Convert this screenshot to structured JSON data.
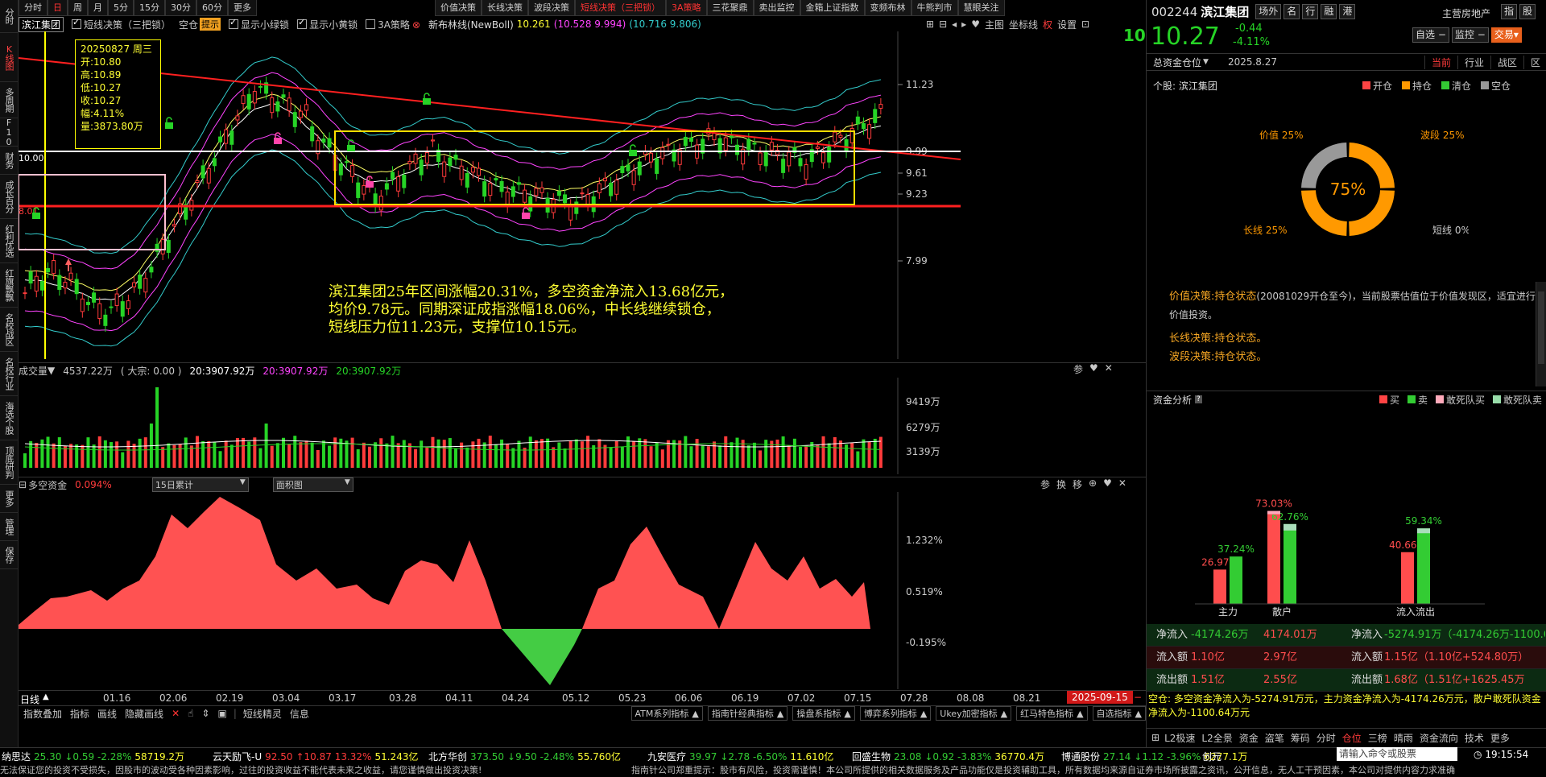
{
  "left_tabs": [
    "分时",
    "K线图",
    "多周期",
    "F10",
    "财务",
    "成长百分",
    "红利优选",
    "红旗飘飘",
    "名校战区",
    "名校行业",
    "海选个股",
    "顶底研判",
    "更多",
    "管理",
    "保存"
  ],
  "period_tabs": [
    "分时",
    "日",
    "周",
    "月",
    "5分",
    "15分",
    "30分",
    "60分",
    "更多"
  ],
  "period_active": "日",
  "decision_tabs": [
    "价值决策",
    "长线决策",
    "波段决策",
    "短线决策（三把锁）",
    "3A策略",
    "三花聚鼎",
    "卖出监控",
    "金箱上证指数",
    "变频布林",
    "牛熊判市",
    "慧眼关注"
  ],
  "decision_red": [
    "短线决策（三把锁）",
    "3A策略"
  ],
  "main_sub": {
    "name": "滨江集团",
    "indicator": "短线决策（三把锁）",
    "kongcang": "空仓",
    "tips": "提示",
    "opt1": "显示小绿锁",
    "opt2": "显示小黄锁",
    "opt3": "3A策略",
    "boll": "新布林线(NewBoll)",
    "boll_v1": "10.261",
    "boll_v2": "(10.528 9.994)",
    "boll_v3": "(10.716 9.806)",
    "right_tools": [
      "主图",
      "坐标线",
      "权",
      "设置"
    ],
    "right_big": "10.27"
  },
  "tooltip": {
    "date": "20250827  周三",
    "open": "开:10.80",
    "high": "高:10.89",
    "low": "低:10.27",
    "close": "收:10.27",
    "change": "幅:4.11%",
    "vol": "量:3873.80万"
  },
  "price_axis": [
    "11.23",
    "9.99",
    "9.61",
    "9.23",
    "7.99"
  ],
  "left_labels": {
    "l1": "10.00",
    "l2": "8.01"
  },
  "annotation": [
    "滨江集团25年区间涨幅20.31%，多空资金净流入13.68亿元，",
    "均价9.78元。同期深证成指涨幅18.06%，中长线继续锁仓，",
    "短线压力位11.23元，支撑位10.15元。"
  ],
  "volume_hdr": {
    "title": "成交量",
    "v1": "4537.22万",
    "v2": "( 大宗: 0.00 )",
    "v3": "20:3907.92万",
    "v4": "20:3907.92万",
    "v5": "20:3907.92万",
    "axis": [
      "9419万",
      "6279万",
      "3139万"
    ]
  },
  "flow_hdr": {
    "title": "多空资金",
    "pct": "0.094%",
    "select1": "15日累计",
    "select2": "面积图",
    "axis": [
      "1.232%",
      "0.519%",
      "-0.195%"
    ],
    "tools": [
      "参",
      "换",
      "移"
    ]
  },
  "x_axis": [
    "01.16",
    "02.06",
    "02.19",
    "03.04",
    "03.17",
    "03.28",
    "04.11",
    "04.24",
    "05.12",
    "05.23",
    "06.06",
    "06.19",
    "07.02",
    "07.15",
    "07.28",
    "08.08",
    "08.21"
  ],
  "x_axis_left": "日线",
  "x_axis_date": "2025-09-15",
  "indicator_bar": [
    "指数叠加",
    "指标",
    "画线",
    "隐藏画线",
    "短线精灵",
    "信息"
  ],
  "indicator_groups": [
    "ATM系列指标",
    "指南针经典指标",
    "操盘系指标",
    "博弈系列指标",
    "Ukey加密指标",
    "红马特色指标",
    "自选指标"
  ],
  "right": {
    "code": "002244",
    "name": "滨江集团",
    "tags": [
      "场外",
      "名",
      "行",
      "融",
      "港"
    ],
    "sector": "主营房地产",
    "sector_btns": [
      "指",
      "股"
    ],
    "price": "10.27",
    "chg": "-0.44",
    "chg_pct": "-4.11%",
    "btn_select": "自选",
    "btn_monitor": "监控",
    "btn_trade": "交易",
    "pos_title": "总资金仓位",
    "pos_date": "2025.8.27",
    "pos_tabs": [
      "当前",
      "行业",
      "战区",
      "区"
    ],
    "stock_label": "个股: 滨江集团",
    "legend": [
      "开仓",
      "持仓",
      "清仓",
      "空仓"
    ],
    "donut_center": "75%",
    "donut_labels": {
      "v": "价值 25%",
      "b": "波段 25%",
      "l": "长线 25%",
      "s": "短线 0%"
    },
    "donut_values": [
      25,
      25,
      25,
      25
    ],
    "decisions": [
      {
        "k": "价值决策:",
        "v": "持仓状态",
        "t": "(20081029开仓至今)，当前股票估值位于价值发现区，适宜进行价值投资。"
      },
      {
        "k": "长线决策:",
        "v": "持仓状态。",
        "t": ""
      },
      {
        "k": "波段决策:",
        "v": "持仓状态。",
        "t": ""
      }
    ],
    "fund_title": "资金分析",
    "fund_legend": [
      "买",
      "卖",
      "敢死队买",
      "敢死队卖"
    ],
    "bars1": {
      "labels": [
        "主力",
        "散户"
      ],
      "pcts": [
        "26.97%",
        "37.24%",
        "73.03%",
        "62.76%"
      ],
      "values": [
        26.97,
        37.24,
        73.03,
        62.76
      ]
    },
    "bars2": {
      "label": "流入流出",
      "pcts": [
        "40.66%",
        "59.34%"
      ],
      "values": [
        40.66,
        59.34
      ]
    },
    "table": [
      {
        "a": "净流入",
        "b": "-4174.26万",
        "c": "4174.01万",
        "d": "净流入",
        "e": "-5274.91万（-4174.26万-1100.6"
      },
      {
        "a": "流入额",
        "b": "1.10亿",
        "c": "2.97亿",
        "d": "流入额",
        "e": "1.15亿（1.10亿+524.80万）"
      },
      {
        "a": "流出额",
        "b": "1.51亿",
        "c": "2.55亿",
        "d": "流出额",
        "e": "1.68亿（1.51亿+1625.45万"
      }
    ],
    "summary": "空仓: 多空资金净流入为-5274.91万元，主力资金净流入为-4174.26万元，散户敢死队资金净流入为-1100.64万元",
    "bottom_tabs": [
      "L2极速",
      "L2全景",
      "资金",
      "盗笔",
      "筹码",
      "分时",
      "仓位",
      "三榜",
      "晴雨",
      "资金流向",
      "技术",
      "更多"
    ],
    "bottom_active": "仓位"
  },
  "ticker": [
    {
      "n": "纳思达",
      "v": "25.30",
      "c": "↓0.59 -2.28%",
      "a": "58719.2万",
      "up": false
    },
    {
      "n": "云天励飞-U",
      "v": "92.50",
      "c": "↑10.87 13.32%",
      "a": "51.243亿",
      "up": true
    },
    {
      "n": "北方华创",
      "v": "373.50",
      "c": "↓9.50 -2.48%",
      "a": "55.760亿",
      "up": false
    },
    {
      "n": "九安医疗",
      "v": "39.97",
      "c": "↓2.78 -6.50%",
      "a": "11.610亿",
      "up": false
    },
    {
      "n": "回盛生物",
      "v": "23.08",
      "c": "↓0.92 -3.83%",
      "a": "36770.4万",
      "up": false
    },
    {
      "n": "博通股份",
      "v": "27.14",
      "c": "↓1.12 -3.96%",
      "a": "6277.1万",
      "up": false
    },
    {
      "n": "创元",
      "v": "",
      "c": "",
      "a": "",
      "up": false
    }
  ],
  "cmd_placeholder": "请输入命令或股票",
  "clock": "19:15:54",
  "disclaimer_left": "无法保证您的投资不受损失，因股市的波动受各种因素影响，过往的投资收益不能代表未来之收益，请您谨慎做出投资决策!",
  "disclaimer_mid": "指南针公司郑重提示：股市有风险，投资需谨慎！本公司所提供的相关数据服务及产品功能仅是投资辅助工具，所有数据均来源自证券市场所披露之资讯，公开信息，无人工干预因素，本公司对提供内容力求准确"
}
